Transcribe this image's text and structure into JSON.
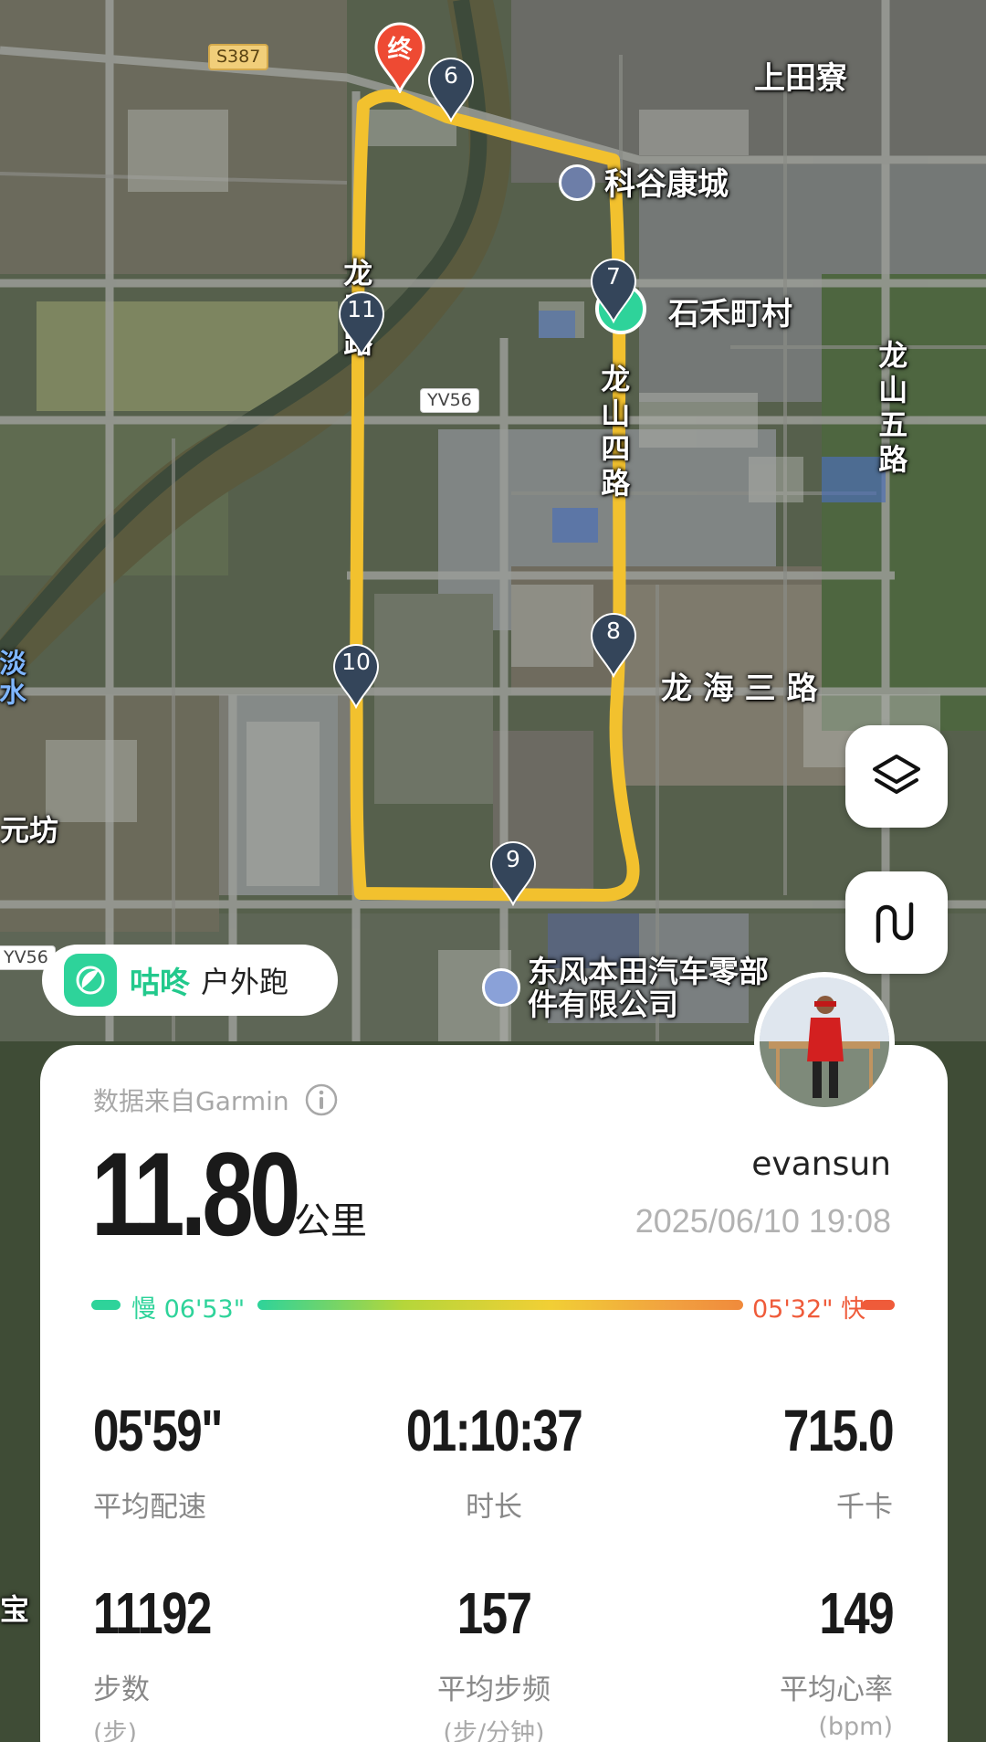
{
  "map": {
    "labels": {
      "shangtianliao": "上田寮",
      "kegu_kangcheng": "科谷康城",
      "shihe_dingcun": "石禾町村",
      "longshan_wulu": "龙山五路",
      "longhai_sanlu": "龙 海 三 路",
      "dongfeng_honda": "东风本田汽车零部件有限公司",
      "yuanfang": "元坊",
      "bao": "宝",
      "road_s387": "S387",
      "road_yv56": "YV56",
      "road_yv56_left": "YV56",
      "vert_left": "龙王路",
      "vert_mid": "龙山四路",
      "edge_left": "淡水"
    },
    "markers": {
      "end": "终",
      "m6": "6",
      "m7": "7",
      "m8": "8",
      "m9": "9",
      "m10": "10",
      "m11": "11"
    },
    "route_color": "#f2c12e",
    "buttons": {
      "layers": "layers-icon",
      "route": "route-icon"
    }
  },
  "app_tag": {
    "brand": "咕咚",
    "mode": "户外跑"
  },
  "card": {
    "source": "数据来自Garmin",
    "distance": "11.80",
    "unit": "公里",
    "username": "evansun",
    "datetime": "2025/06/10 19:08",
    "pace_slow": "慢 06'53\"",
    "pace_fast": "05'32\" 快",
    "stats": [
      {
        "value": "05'59\"",
        "label": "平均配速",
        "sub": ""
      },
      {
        "value": "01:10:37",
        "label": "时长",
        "sub": ""
      },
      {
        "value": "715.0",
        "label": "千卡",
        "sub": ""
      },
      {
        "value": "11192",
        "label": "步数",
        "sub": "(步)"
      },
      {
        "value": "157",
        "label": "平均步频",
        "sub": "(步/分钟)"
      },
      {
        "value": "149",
        "label": "平均心率",
        "sub": "(bpm)"
      }
    ]
  },
  "colors": {
    "slow": "#2ed39a",
    "fast": "#ef5b3a",
    "brand": "#22c98c"
  }
}
